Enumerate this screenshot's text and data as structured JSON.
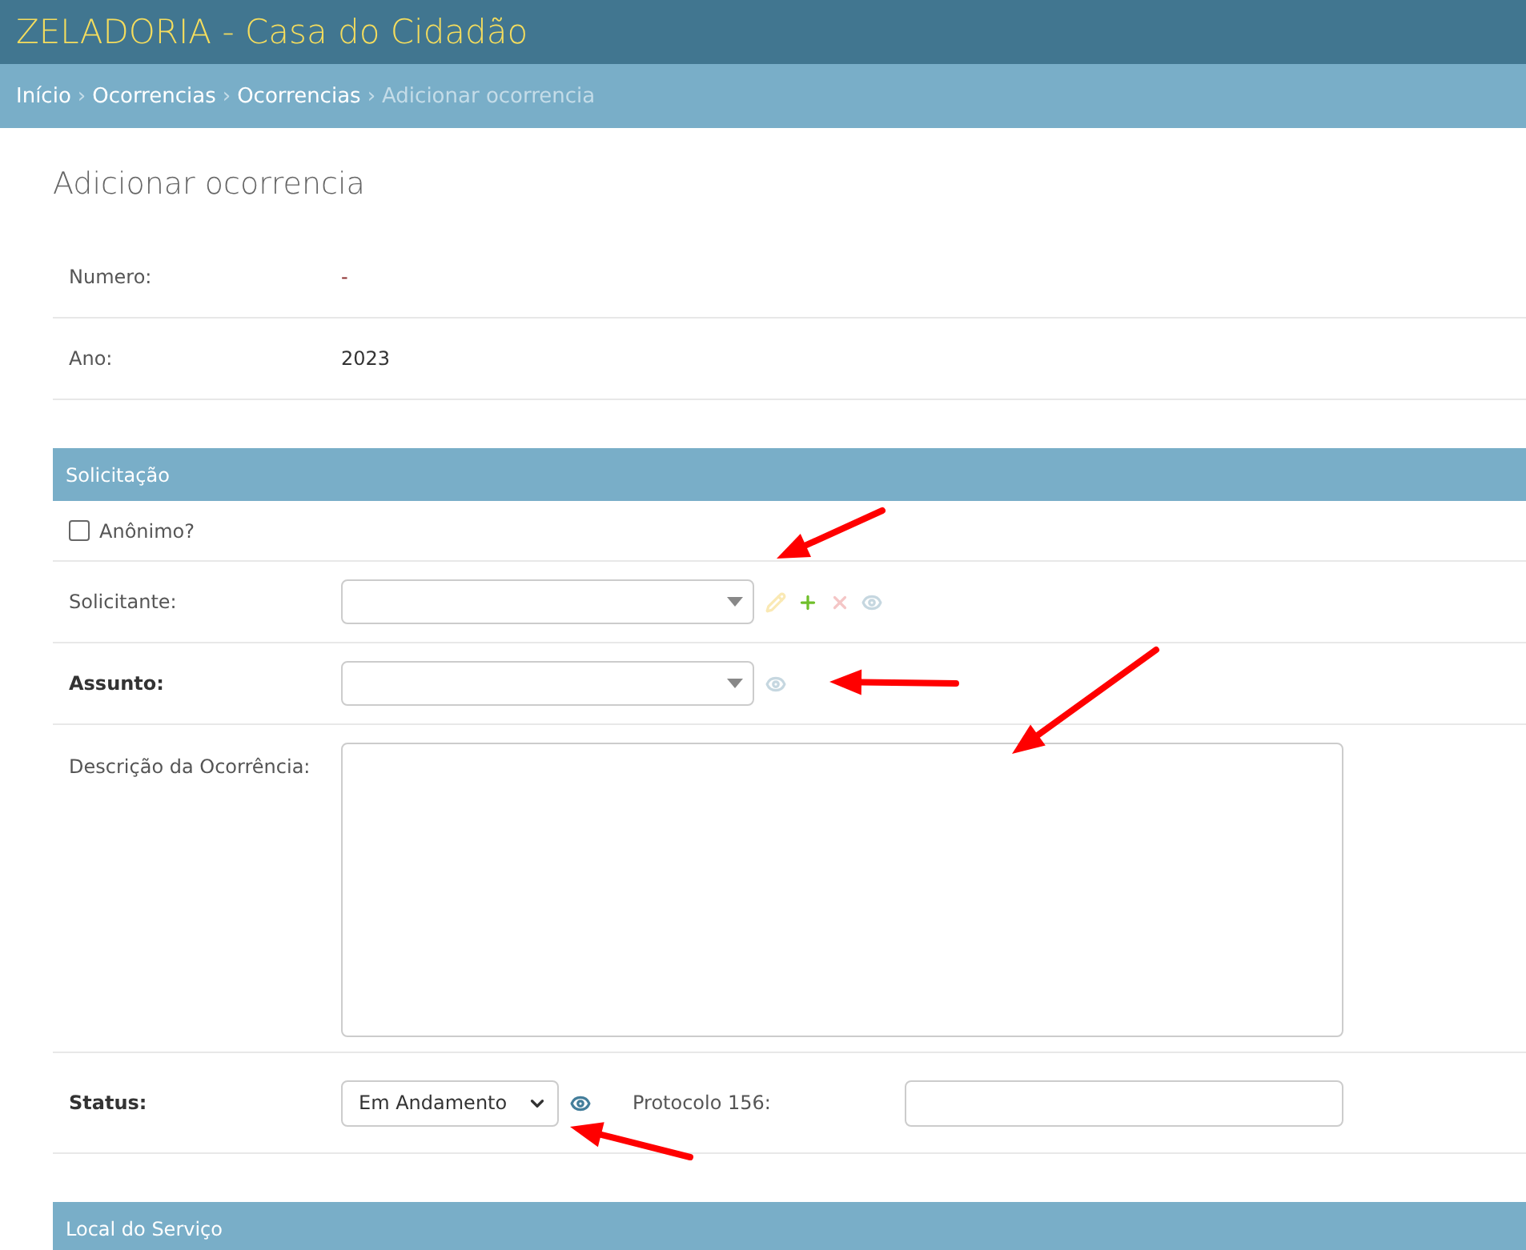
{
  "header": {
    "title": "ZELADORIA - Casa do Cidadão"
  },
  "breadcrumbs": [
    {
      "label": "Início",
      "current": false
    },
    {
      "label": "Ocorrencias",
      "current": false
    },
    {
      "label": "Ocorrencias",
      "current": false
    },
    {
      "label": "Adicionar ocorrencia",
      "current": true
    }
  ],
  "breadcrumb_separator": "›",
  "page_title": "Adicionar ocorrencia",
  "readonly_fields": [
    {
      "label": "Numero:",
      "value": "-",
      "empty": true
    },
    {
      "label": "Ano:",
      "value": "2023",
      "empty": false
    }
  ],
  "fieldsets": [
    {
      "title": "Solicitação",
      "rows": [
        {
          "kind": "checkbox",
          "label": "Anônimo?",
          "checked": false
        },
        {
          "kind": "search_select",
          "label": "Solicitante:",
          "required": false,
          "actions": [
            {
              "kind": "edit",
              "disabled": true
            },
            {
              "kind": "add",
              "disabled": false
            },
            {
              "kind": "delete",
              "disabled": true
            },
            {
              "kind": "view",
              "disabled": true
            }
          ]
        },
        {
          "kind": "search_select",
          "label": "Assunto:",
          "required": true,
          "actions": [
            {
              "kind": "view",
              "disabled": true
            }
          ]
        },
        {
          "kind": "textarea",
          "label": "Descrição da Ocorrência:",
          "required": false
        },
        {
          "kind": "select",
          "label": "Status:",
          "required": true,
          "value": "Em Andamento",
          "actions": [
            {
              "kind": "view",
              "disabled": false
            }
          ],
          "extra_field": {
            "label": "Protocolo 156:"
          }
        }
      ]
    },
    {
      "title": "Local do Serviço"
    }
  ]
}
